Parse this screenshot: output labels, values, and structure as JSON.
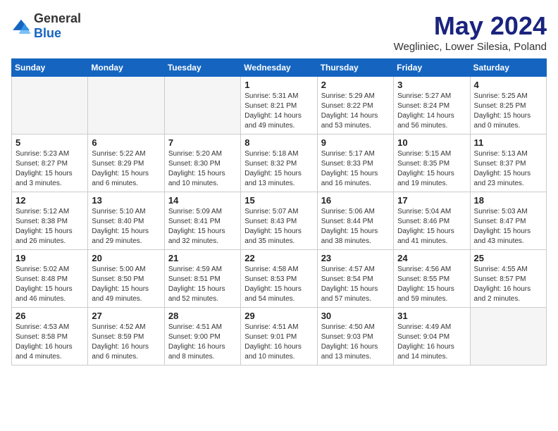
{
  "header": {
    "logo": {
      "general": "General",
      "blue": "Blue"
    },
    "month": "May 2024",
    "location": "Wegliniec, Lower Silesia, Poland"
  },
  "weekdays": [
    "Sunday",
    "Monday",
    "Tuesday",
    "Wednesday",
    "Thursday",
    "Friday",
    "Saturday"
  ],
  "weeks": [
    [
      {
        "day": "",
        "info": ""
      },
      {
        "day": "",
        "info": ""
      },
      {
        "day": "",
        "info": ""
      },
      {
        "day": "1",
        "info": "Sunrise: 5:31 AM\nSunset: 8:21 PM\nDaylight: 14 hours\nand 49 minutes."
      },
      {
        "day": "2",
        "info": "Sunrise: 5:29 AM\nSunset: 8:22 PM\nDaylight: 14 hours\nand 53 minutes."
      },
      {
        "day": "3",
        "info": "Sunrise: 5:27 AM\nSunset: 8:24 PM\nDaylight: 14 hours\nand 56 minutes."
      },
      {
        "day": "4",
        "info": "Sunrise: 5:25 AM\nSunset: 8:25 PM\nDaylight: 15 hours\nand 0 minutes."
      }
    ],
    [
      {
        "day": "5",
        "info": "Sunrise: 5:23 AM\nSunset: 8:27 PM\nDaylight: 15 hours\nand 3 minutes."
      },
      {
        "day": "6",
        "info": "Sunrise: 5:22 AM\nSunset: 8:29 PM\nDaylight: 15 hours\nand 6 minutes."
      },
      {
        "day": "7",
        "info": "Sunrise: 5:20 AM\nSunset: 8:30 PM\nDaylight: 15 hours\nand 10 minutes."
      },
      {
        "day": "8",
        "info": "Sunrise: 5:18 AM\nSunset: 8:32 PM\nDaylight: 15 hours\nand 13 minutes."
      },
      {
        "day": "9",
        "info": "Sunrise: 5:17 AM\nSunset: 8:33 PM\nDaylight: 15 hours\nand 16 minutes."
      },
      {
        "day": "10",
        "info": "Sunrise: 5:15 AM\nSunset: 8:35 PM\nDaylight: 15 hours\nand 19 minutes."
      },
      {
        "day": "11",
        "info": "Sunrise: 5:13 AM\nSunset: 8:37 PM\nDaylight: 15 hours\nand 23 minutes."
      }
    ],
    [
      {
        "day": "12",
        "info": "Sunrise: 5:12 AM\nSunset: 8:38 PM\nDaylight: 15 hours\nand 26 minutes."
      },
      {
        "day": "13",
        "info": "Sunrise: 5:10 AM\nSunset: 8:40 PM\nDaylight: 15 hours\nand 29 minutes."
      },
      {
        "day": "14",
        "info": "Sunrise: 5:09 AM\nSunset: 8:41 PM\nDaylight: 15 hours\nand 32 minutes."
      },
      {
        "day": "15",
        "info": "Sunrise: 5:07 AM\nSunset: 8:43 PM\nDaylight: 15 hours\nand 35 minutes."
      },
      {
        "day": "16",
        "info": "Sunrise: 5:06 AM\nSunset: 8:44 PM\nDaylight: 15 hours\nand 38 minutes."
      },
      {
        "day": "17",
        "info": "Sunrise: 5:04 AM\nSunset: 8:46 PM\nDaylight: 15 hours\nand 41 minutes."
      },
      {
        "day": "18",
        "info": "Sunrise: 5:03 AM\nSunset: 8:47 PM\nDaylight: 15 hours\nand 43 minutes."
      }
    ],
    [
      {
        "day": "19",
        "info": "Sunrise: 5:02 AM\nSunset: 8:48 PM\nDaylight: 15 hours\nand 46 minutes."
      },
      {
        "day": "20",
        "info": "Sunrise: 5:00 AM\nSunset: 8:50 PM\nDaylight: 15 hours\nand 49 minutes."
      },
      {
        "day": "21",
        "info": "Sunrise: 4:59 AM\nSunset: 8:51 PM\nDaylight: 15 hours\nand 52 minutes."
      },
      {
        "day": "22",
        "info": "Sunrise: 4:58 AM\nSunset: 8:53 PM\nDaylight: 15 hours\nand 54 minutes."
      },
      {
        "day": "23",
        "info": "Sunrise: 4:57 AM\nSunset: 8:54 PM\nDaylight: 15 hours\nand 57 minutes."
      },
      {
        "day": "24",
        "info": "Sunrise: 4:56 AM\nSunset: 8:55 PM\nDaylight: 15 hours\nand 59 minutes."
      },
      {
        "day": "25",
        "info": "Sunrise: 4:55 AM\nSunset: 8:57 PM\nDaylight: 16 hours\nand 2 minutes."
      }
    ],
    [
      {
        "day": "26",
        "info": "Sunrise: 4:53 AM\nSunset: 8:58 PM\nDaylight: 16 hours\nand 4 minutes."
      },
      {
        "day": "27",
        "info": "Sunrise: 4:52 AM\nSunset: 8:59 PM\nDaylight: 16 hours\nand 6 minutes."
      },
      {
        "day": "28",
        "info": "Sunrise: 4:51 AM\nSunset: 9:00 PM\nDaylight: 16 hours\nand 8 minutes."
      },
      {
        "day": "29",
        "info": "Sunrise: 4:51 AM\nSunset: 9:01 PM\nDaylight: 16 hours\nand 10 minutes."
      },
      {
        "day": "30",
        "info": "Sunrise: 4:50 AM\nSunset: 9:03 PM\nDaylight: 16 hours\nand 13 minutes."
      },
      {
        "day": "31",
        "info": "Sunrise: 4:49 AM\nSunset: 9:04 PM\nDaylight: 16 hours\nand 14 minutes."
      },
      {
        "day": "",
        "info": ""
      }
    ]
  ]
}
